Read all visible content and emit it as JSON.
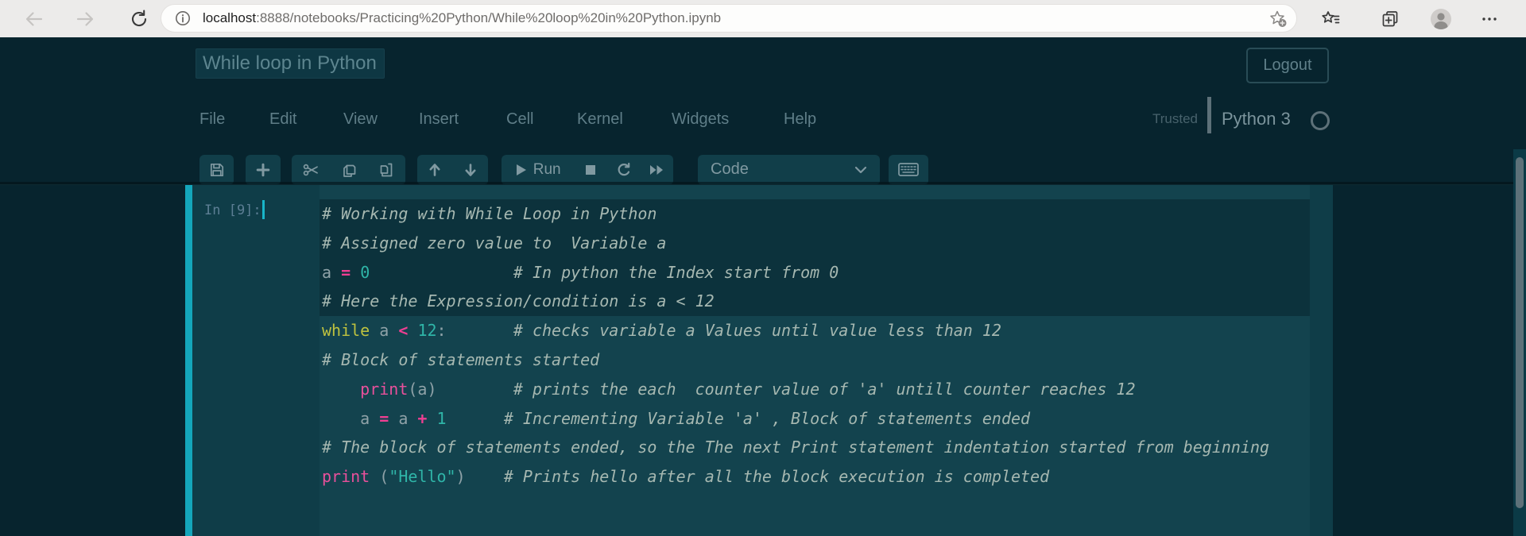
{
  "browser": {
    "url_host": "localhost",
    "url_rest": ":8888/notebooks/Practicing%20Python/While%20loop%20in%20Python.ipynb"
  },
  "header": {
    "title": "While loop in Python",
    "logout_label": "Logout",
    "menu": {
      "file": "File",
      "edit": "Edit",
      "view": "View",
      "insert": "Insert",
      "cell": "Cell",
      "kernel": "Kernel",
      "widgets": "Widgets",
      "help": "Help"
    },
    "trusted_label": "Trusted",
    "kernel_name": "Python 3"
  },
  "toolbar": {
    "run_label": "Run",
    "cell_type": "Code"
  },
  "cell": {
    "prompt": "In [9]:",
    "code_lines": [
      [
        [
          "c",
          "# Working with While Loop in Python"
        ]
      ],
      [
        [
          "c",
          "# Assigned zero value to  Variable a"
        ]
      ],
      [
        [
          "d",
          "a "
        ],
        [
          "o",
          "="
        ],
        [
          "d",
          " "
        ],
        [
          "n",
          "0"
        ],
        [
          "d",
          "               "
        ],
        [
          "c",
          "# In python the Index start from 0"
        ]
      ],
      [
        [
          "c",
          "# Here the Expression/condition is a < 12"
        ]
      ],
      [
        [
          "k",
          "while"
        ],
        [
          "d",
          " a "
        ],
        [
          "o",
          "<"
        ],
        [
          "d",
          " "
        ],
        [
          "n",
          "12"
        ],
        [
          "d",
          ":"
        ],
        [
          "d",
          "       "
        ],
        [
          "c",
          "# checks variable a Values until value less than 12"
        ]
      ],
      [
        [
          "c",
          "# Block of statements started"
        ]
      ],
      [
        [
          "d",
          "    "
        ],
        [
          "b",
          "print"
        ],
        [
          "d",
          "(a)"
        ],
        [
          "d",
          "        "
        ],
        [
          "c",
          "# prints the each  counter value of 'a' untill counter reaches 12"
        ]
      ],
      [
        [
          "d",
          "    a "
        ],
        [
          "o",
          "="
        ],
        [
          "d",
          " a "
        ],
        [
          "o",
          "+"
        ],
        [
          "d",
          " "
        ],
        [
          "n",
          "1"
        ],
        [
          "d",
          "      "
        ],
        [
          "c",
          "# Incrementing Variable 'a' , Block of statements ended"
        ]
      ],
      [
        [
          "c",
          "# The block of statements ended, so the The next Print statement indentation started from beginning"
        ]
      ],
      [
        [
          "b",
          "print"
        ],
        [
          "d",
          " ("
        ],
        [
          "s",
          "\"Hello\""
        ],
        [
          "d",
          ")"
        ],
        [
          "d",
          "    "
        ],
        [
          "c",
          "# Prints hello after all the block execution is completed"
        ]
      ]
    ]
  },
  "colors": {
    "page_bg": "#07242e",
    "cell_bg": "#0f3d48",
    "editor_bg": "#13434e",
    "selection_bg": "#0c323c",
    "selected_cell_border": "#14a6bb",
    "keyword": "#bec23f",
    "builtin_and_operator": "#e8509b",
    "number_and_string": "#2fb5a8",
    "comment": "#a6b8b1"
  }
}
